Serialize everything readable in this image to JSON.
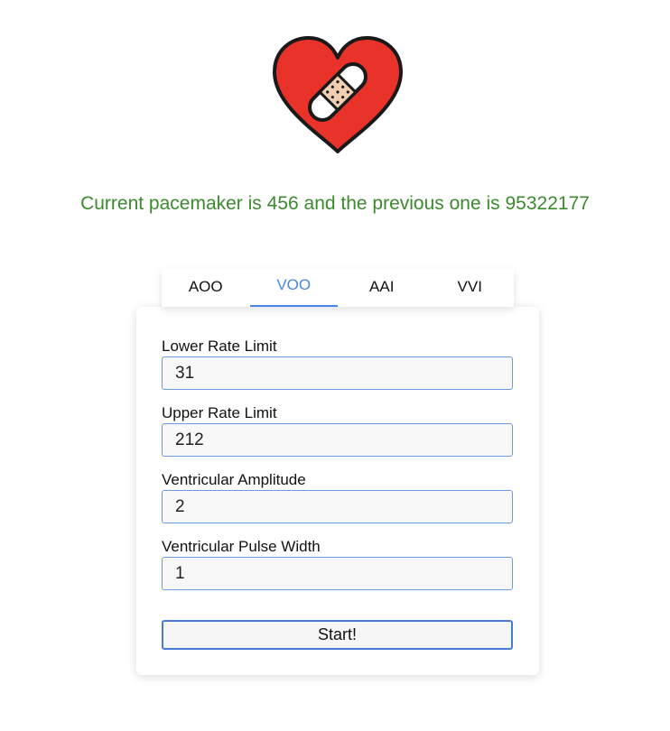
{
  "logo": {
    "icon": "heart-bandage-icon",
    "colors": {
      "heart": "#e8322a",
      "bandage": "#f0d0b0",
      "outline": "#1a1a1a"
    }
  },
  "status": {
    "text": "Current pacemaker is 456 and the previous one is 95322177",
    "color": "#3c8a2e"
  },
  "tabs": [
    {
      "label": "AOO",
      "active": false
    },
    {
      "label": "VOO",
      "active": true
    },
    {
      "label": "AAI",
      "active": false
    },
    {
      "label": "VVI",
      "active": false
    }
  ],
  "form": {
    "fields": [
      {
        "label": "Lower Rate Limit",
        "value": "31"
      },
      {
        "label": "Upper Rate Limit",
        "value": "212"
      },
      {
        "label": "Ventricular Amplitude",
        "value": "2"
      },
      {
        "label": "Ventricular Pulse Width",
        "value": "1"
      }
    ],
    "submit_label": "Start!"
  },
  "accent_color": "#4a86e8"
}
